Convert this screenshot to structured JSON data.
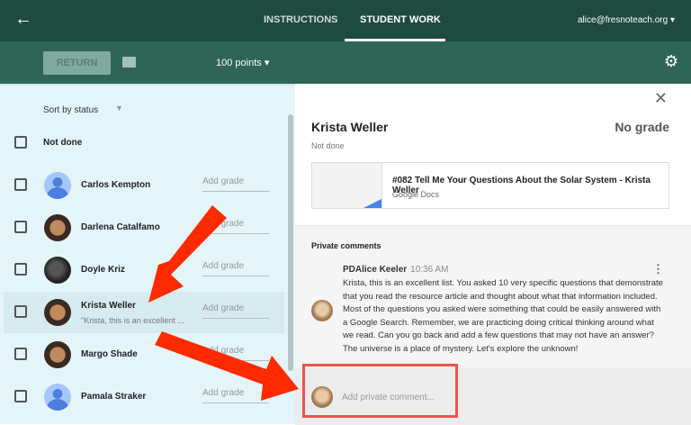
{
  "header": {
    "back_icon": "arrow-left-icon",
    "tabs": [
      {
        "label": "INSTRUCTIONS",
        "active": false
      },
      {
        "label": "STUDENT WORK",
        "active": true
      }
    ],
    "account": "alice@fresnoteach.org ▾"
  },
  "toolbar": {
    "return_label": "RETURN",
    "mail_icon": "mail-icon",
    "points": "100 points ▾",
    "settings_icon": "gear-icon"
  },
  "list": {
    "sort": "Sort by status",
    "group": "Not done",
    "grade_placeholder": "Add grade",
    "students": [
      {
        "name": "Carlos Kempton",
        "snippet": "",
        "avatar": "default"
      },
      {
        "name": "Darlena Catalfamo",
        "snippet": "",
        "avatar": "cartoon"
      },
      {
        "name": "Doyle Kriz",
        "snippet": "",
        "avatar": "photo"
      },
      {
        "name": "Krista Weller",
        "snippet": "\"Krista, this is an excellent ...",
        "avatar": "cartoon",
        "selected": true
      },
      {
        "name": "Margo Shade",
        "snippet": "",
        "avatar": "cartoon"
      },
      {
        "name": "Pamala Straker",
        "snippet": "",
        "avatar": "default"
      }
    ]
  },
  "detail": {
    "name": "Krista Weller",
    "grade": "No grade",
    "status": "Not done",
    "attachment": {
      "title": "#082 Tell Me Your Questions About the Solar System - Krista Weller",
      "type": "Google Docs"
    },
    "comments_header": "Private comments",
    "comment": {
      "author": "PDAlice Keeler",
      "time": "10:36 AM",
      "text": "Krista, this is an excellent list. You asked 10 very specific questions that demonstrate that you read the resource article and thought about what that information included. Most of the questions you asked were something that could be easily answered with a Google Search. Remember, we are practicing doing critical thinking around what we read. Can you go back and add a few questions that may not have an answer? The universe is a place of mystery. Let's explore the unknown!"
    },
    "comment_placeholder": "Add private comment..."
  },
  "colors": {
    "header": "#1f4a3f",
    "toolbar": "#2e6557",
    "list_bg": "#e3f5f9",
    "annotation_arrow": "#ff2a00",
    "highlight_box": "#e8564c"
  }
}
